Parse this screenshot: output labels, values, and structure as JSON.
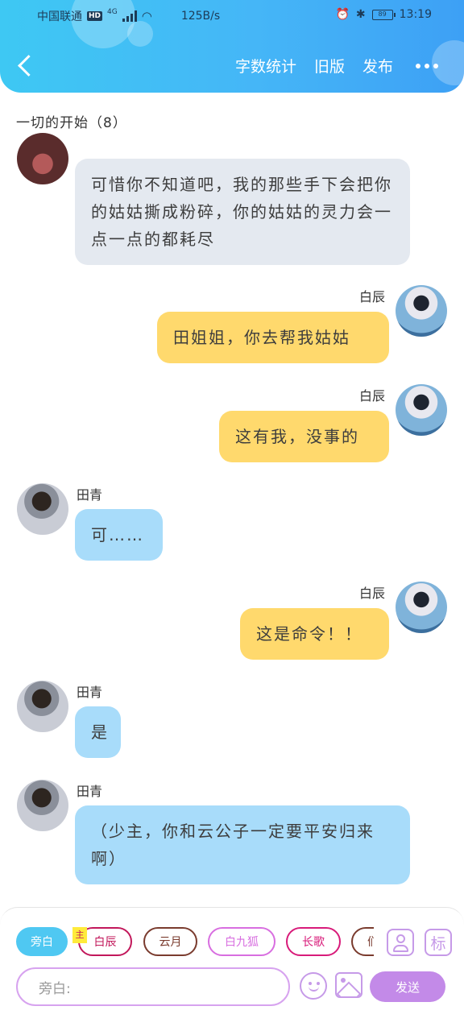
{
  "status_bar": {
    "carrier": "中国联通",
    "hd": "HD",
    "network": "4G",
    "speed": "125B/s",
    "battery": "89",
    "time": "13:19"
  },
  "header": {
    "links": [
      "字数统计",
      "旧版",
      "发布"
    ]
  },
  "chapter": {
    "title": "一切的开始（8）"
  },
  "messages": [
    {
      "side": "left",
      "sender": "",
      "text": "可惜你不知道吧，我的那些手下会把你的姑姑撕成粉碎，你的姑姑的灵力会一点一点的都耗尽"
    },
    {
      "side": "right",
      "sender": "白辰",
      "text": "田姐姐，你去帮我姑姑"
    },
    {
      "side": "right",
      "sender": "白辰",
      "text": "这有我，没事的"
    },
    {
      "side": "left",
      "sender": "田青",
      "text": "可……"
    },
    {
      "side": "right",
      "sender": "白辰",
      "text": "这是命令！！"
    },
    {
      "side": "left",
      "sender": "田青",
      "text": "是"
    },
    {
      "side": "left",
      "sender": "田青",
      "text": "（少主，你和云公子一定要平安归来啊）"
    }
  ],
  "composer": {
    "zhu_tag": "主",
    "chips": [
      {
        "label": "旁白",
        "color": "#ffffff"
      },
      {
        "label": "白辰",
        "color": "#c2185b"
      },
      {
        "label": "云月",
        "color": "#7a3b2e"
      },
      {
        "label": "白九狐",
        "color": "#d86ee0"
      },
      {
        "label": "长歌",
        "color": "#d81b7a"
      },
      {
        "label": "们",
        "color": "#7a3b2e"
      }
    ],
    "mark_label": "标",
    "input_placeholder": "旁白:",
    "send_label": "发送"
  }
}
